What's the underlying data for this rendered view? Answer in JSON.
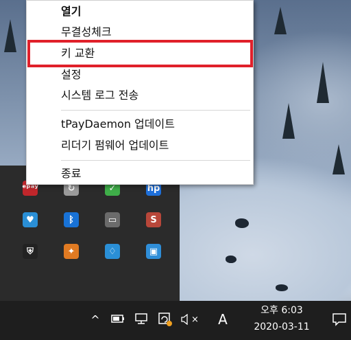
{
  "context_menu": {
    "items": [
      {
        "label": "열기",
        "bold": true
      },
      {
        "label": "무결성체크"
      },
      {
        "label": "키 교환"
      },
      {
        "label": "설정"
      },
      {
        "label": "시스템 로그 전송"
      },
      {
        "label": "tPayDaemon 업데이트"
      },
      {
        "label": "리더기 펌웨어 업데이트"
      },
      {
        "label": "종료"
      }
    ],
    "highlight_color": "#e0202a"
  },
  "tray_icons": [
    {
      "name": "partial-red-icon",
      "glyph": "ᵉᵖᵃʸ",
      "color": "#c0262b"
    },
    {
      "name": "sync-icon",
      "glyph": "↻",
      "color": "#9a9a9a"
    },
    {
      "name": "green-check-icon",
      "glyph": "✓",
      "color": "#3fae49"
    },
    {
      "name": "hp-icon",
      "glyph": "hp",
      "color": "#1e6fd9"
    },
    {
      "name": "shield-heart-icon",
      "glyph": "♥",
      "color": "#2a8fd6"
    },
    {
      "name": "bluetooth-icon",
      "glyph": "ᛒ",
      "color": "#1872d6"
    },
    {
      "name": "network-adapter-icon",
      "glyph": "▭",
      "color": "#6b6b6b"
    },
    {
      "name": "s-shield-icon",
      "glyph": "S",
      "color": "#b8473a"
    },
    {
      "name": "security-warning-icon",
      "glyph": "⛨",
      "color": "#222222"
    },
    {
      "name": "flame-app-icon",
      "glyph": "✦",
      "color": "#e07a22"
    },
    {
      "name": "defender-icon",
      "glyph": "♢",
      "color": "#2a8fd6"
    },
    {
      "name": "display-app-icon",
      "glyph": "▣",
      "color": "#2f8ed8"
    }
  ],
  "taskbar": {
    "chevron": "^",
    "ime": "A",
    "volume_muted": "×",
    "clock": {
      "period_time": "오후 6:03",
      "date": "2020-03-11"
    }
  }
}
